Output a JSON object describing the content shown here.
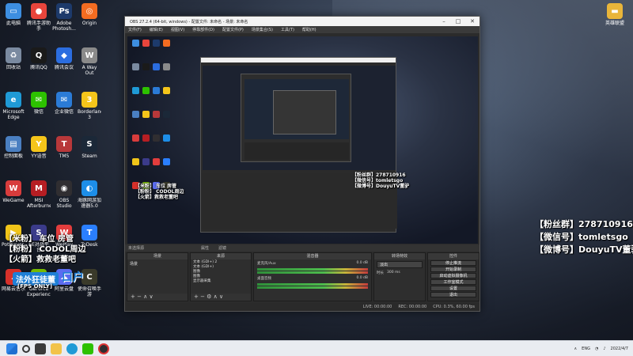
{
  "desktop": {
    "left_icons": [
      {
        "label": "此电脑",
        "color": "#3d8ee0",
        "glyph": "▭"
      },
      {
        "label": "腾讯手游助手",
        "color": "#e8453c",
        "glyph": "●"
      },
      {
        "label": "Adobe Photosh...",
        "color": "#1d3a6b",
        "glyph": "Ps"
      },
      {
        "label": "Origin",
        "color": "#f36c21",
        "glyph": "◎"
      },
      {
        "label": "回收站",
        "color": "#7a8aa0",
        "glyph": "♻"
      },
      {
        "label": "腾讯QQ",
        "color": "#1a1a1a",
        "glyph": "Q"
      },
      {
        "label": "腾讯会议",
        "color": "#2b6de0",
        "glyph": "◆"
      },
      {
        "label": "A Way Out",
        "color": "#8a8a8a",
        "glyph": "W"
      },
      {
        "label": "Microsoft Edge",
        "color": "#1f9ad6",
        "glyph": "e"
      },
      {
        "label": "微信",
        "color": "#2dc100",
        "glyph": "✉"
      },
      {
        "label": "企业微信",
        "color": "#2b7bd6",
        "glyph": "✉"
      },
      {
        "label": "Borderlands 3",
        "color": "#f5c51a",
        "glyph": "3"
      },
      {
        "label": "控制面板",
        "color": "#4a7fc1",
        "glyph": "▤"
      },
      {
        "label": "YY语音",
        "color": "#f5c51a",
        "glyph": "Y"
      },
      {
        "label": "TM5",
        "color": "#b8383a",
        "glyph": "T"
      },
      {
        "label": "Steam",
        "color": "#1b2838",
        "glyph": "S"
      },
      {
        "label": "WeGame",
        "color": "#d83c3c",
        "glyph": "W"
      },
      {
        "label": "MSI Afterburner",
        "color": "#b61e23",
        "glyph": "M"
      },
      {
        "label": "OBS Studio",
        "color": "#302e31",
        "glyph": "◉"
      },
      {
        "label": "海豚网游加速器5.0",
        "color": "#1d8ee8",
        "glyph": "◐"
      },
      {
        "label": "PotPlayer...",
        "color": "#f0c419",
        "glyph": "▶"
      },
      {
        "label": "SE对战平台",
        "color": "#3b3b8a",
        "glyph": "S"
      },
      {
        "label": "WePlay",
        "color": "#e23d3d",
        "glyph": "W"
      },
      {
        "label": "ToDesk",
        "color": "#2a7fff",
        "glyph": "T"
      },
      {
        "label": "网易云音乐",
        "color": "#d6302a",
        "glyph": "♪"
      },
      {
        "label": "GeForce Experience",
        "color": "#76b900",
        "glyph": "◎"
      },
      {
        "label": "阿里云盘",
        "color": "#5b6cf0",
        "glyph": "☁"
      },
      {
        "label": "使命召唤手游",
        "color": "#3a3a2a",
        "glyph": "C"
      }
    ],
    "right_icon": {
      "label": "英雄联盟",
      "color": "#e9b53a",
      "glyph": "▬"
    }
  },
  "overlay_right": {
    "lines": [
      "【粉丝群】278710916",
      "【微信号】tomletsgo",
      "【微博号】DouyuTV董驴"
    ]
  },
  "overlay_left": {
    "lines": [
      "【米粉】 车位 房管",
      "【粉粉】 CODOL周边",
      "【火箭】救救老董吧"
    ],
    "badge": "法外狂徒董",
    "badge2": "口户",
    "fps": "[FPS ONLY]"
  },
  "obs": {
    "title": "OBS 27.2.4 (64-bit, windows) - 配置文件: 未命名 - 场景: 未命名",
    "menu": [
      "文件(F)",
      "编辑(E)",
      "视图(V)",
      "停靠部件(D)",
      "配置文件(P)",
      "场景集合(S)",
      "工具(T)",
      "帮助(H)"
    ],
    "source_bar": [
      "未选择源",
      "属性",
      "滤镜"
    ],
    "docks": {
      "scenes": {
        "title": "场景",
        "items": [
          "场景"
        ]
      },
      "sources": {
        "title": "来源",
        "items": [
          "文本 (GDI+) 2",
          "文本 (GDI+)",
          "图像",
          "图像",
          "显示器采集"
        ]
      },
      "mixer": {
        "title": "混音器",
        "tracks": [
          {
            "name": "麦克风/Aux",
            "db": "0.0 dB"
          },
          {
            "name": "桌面音频",
            "db": "0.0 dB"
          }
        ]
      },
      "transitions": {
        "title": "转场特效",
        "type": "淡出",
        "duration_label": "时长",
        "duration": "300 ms"
      },
      "controls": {
        "title": "控件",
        "buttons": [
          "停止推流",
          "开始录制",
          "启动虚拟摄像机",
          "工作室模式",
          "设置",
          "退出"
        ]
      }
    },
    "status": [
      "LIVE: 00:00:00",
      "REC: 00:00:00",
      "CPU: 0.3%, 60.00 fps"
    ]
  },
  "taskbar": {
    "tray": [
      "ENG",
      "2022/4/7"
    ]
  }
}
